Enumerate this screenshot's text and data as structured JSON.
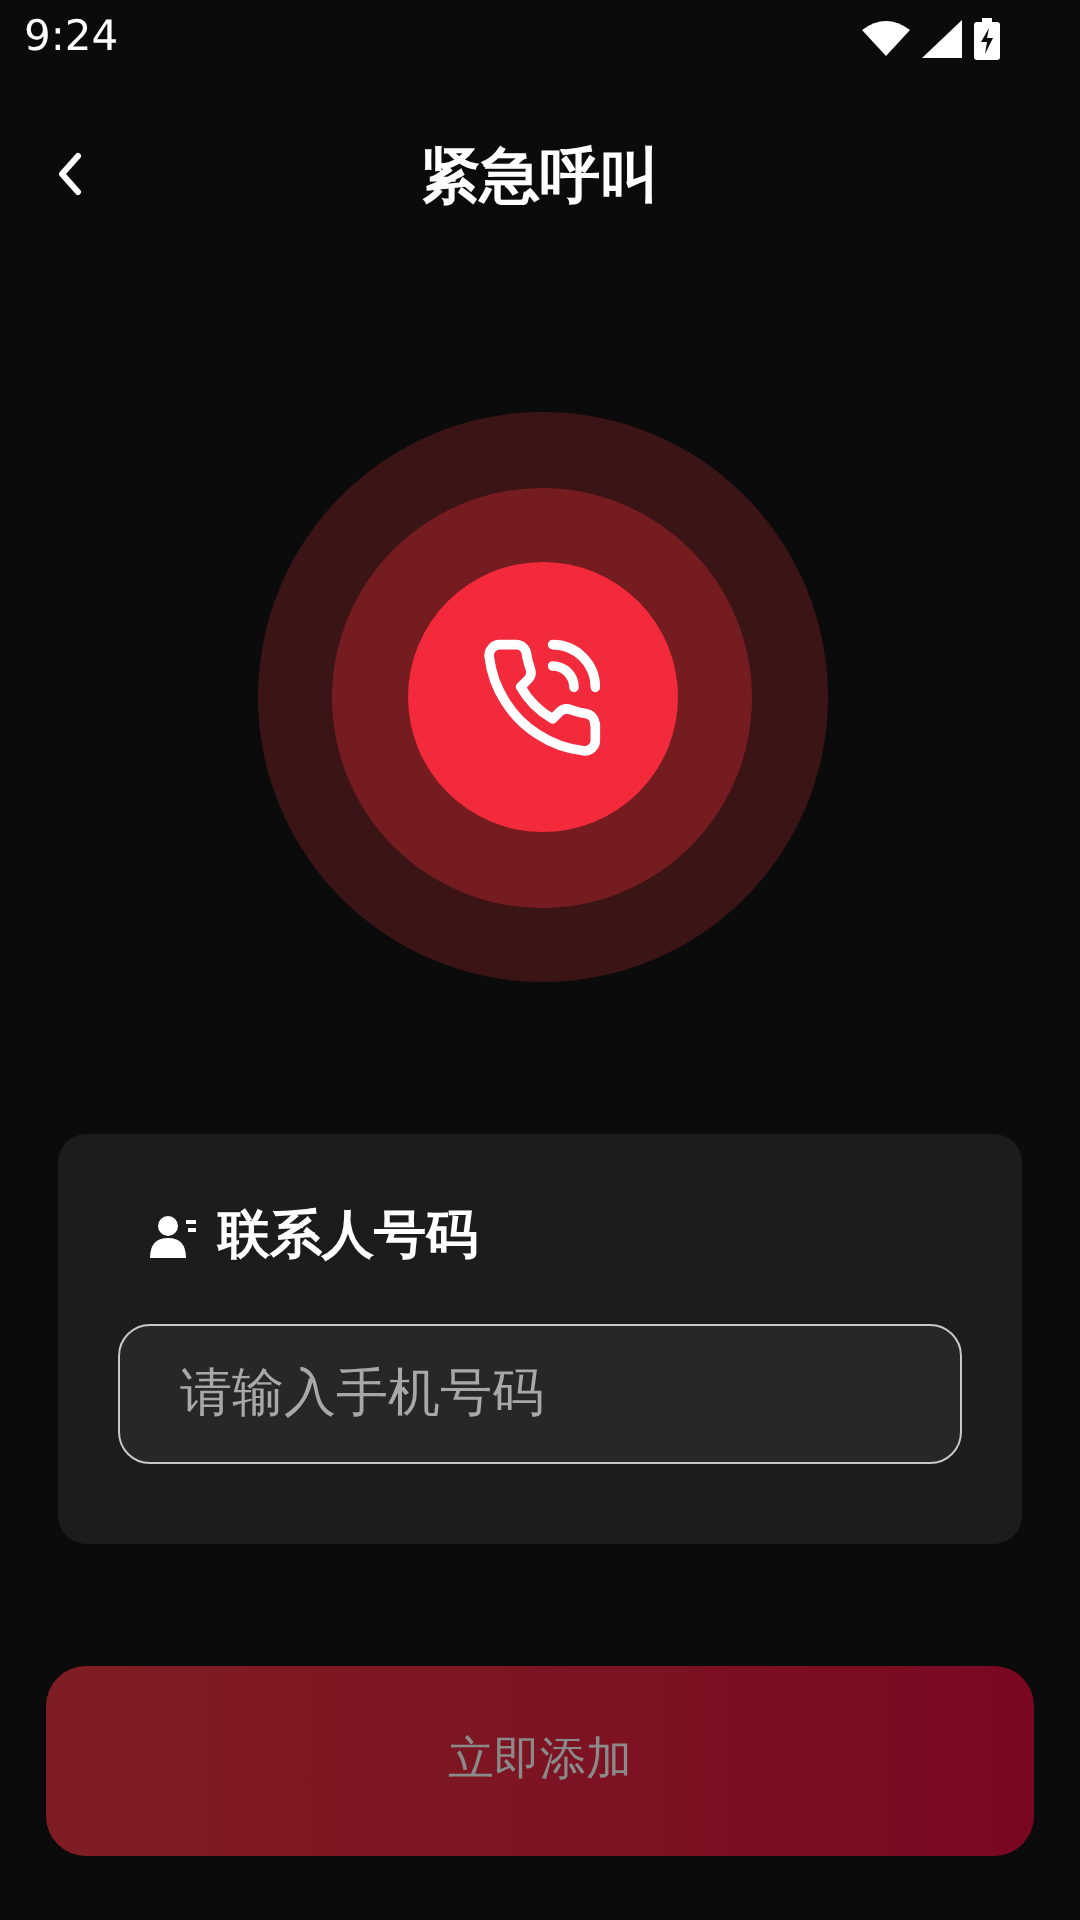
{
  "status_bar": {
    "time": "9:24"
  },
  "header": {
    "title": "紧急呼叫"
  },
  "contact": {
    "label": "联系人号码",
    "phone_field": {
      "placeholder": "请输入手机号码"
    }
  },
  "add_button": {
    "label": "立即添加",
    "disabled": true
  }
}
